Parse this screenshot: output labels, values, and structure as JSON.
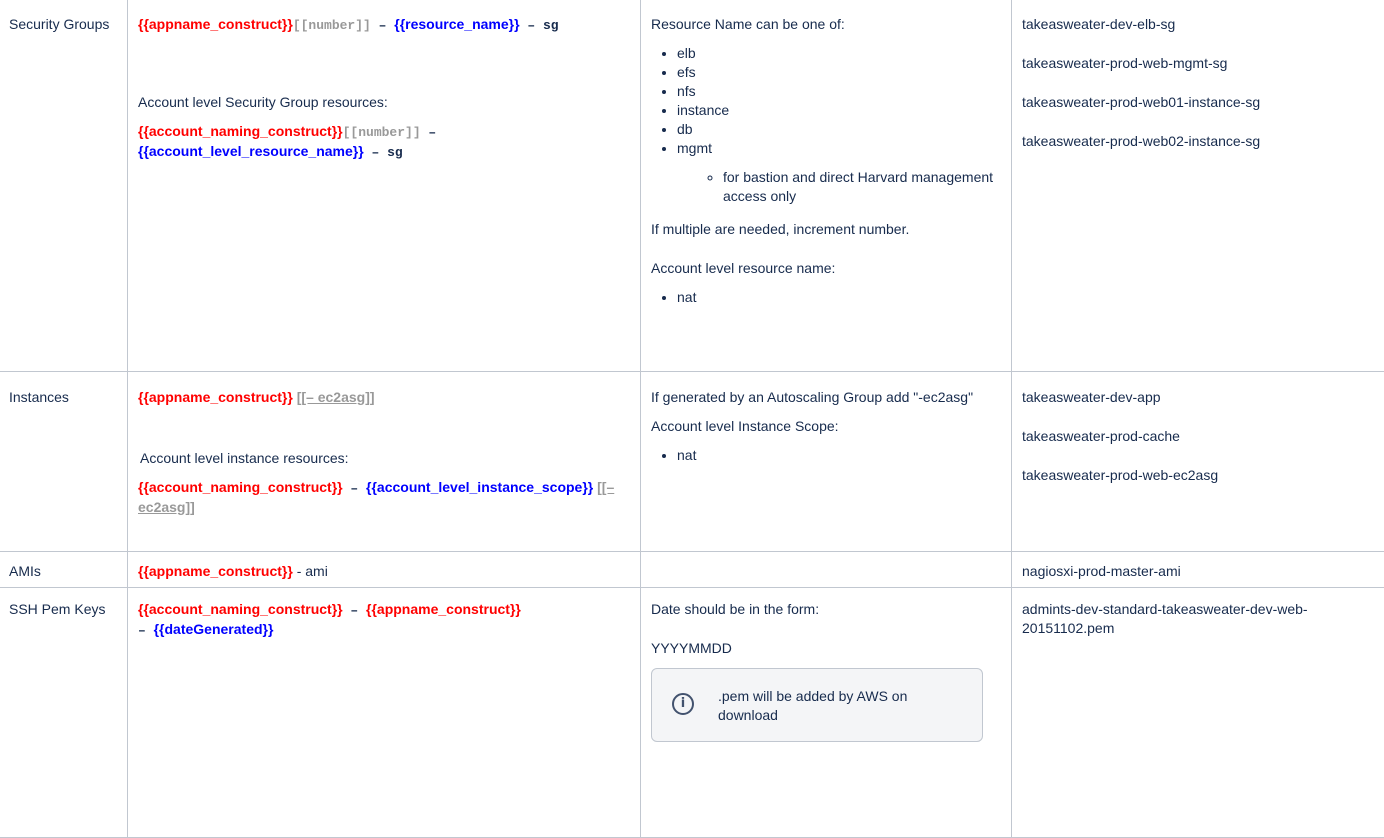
{
  "rows": {
    "sg": {
      "type": "Security Groups",
      "c2": {
        "l1_appname": "{{appname_construct}}",
        "l1_number": "[[number]]",
        "l1_dash": " – ",
        "l1_resource": "{{resource_name}}",
        "l1_suffix": " – sg",
        "account_label": "Account level Security Group resources:",
        "l2_account": "{{account_naming_construct}}",
        "l2_number": "[[number]]",
        "l2_dash": " – ",
        "l2_resource": "{{account_level_resource_name}}",
        "l2_suffix": " – sg"
      },
      "c3": {
        "intro": "Resource Name can be one of:",
        "items": [
          "elb",
          "efs",
          "nfs",
          "instance",
          "db",
          "mgmt"
        ],
        "mgmt_note": "for bastion and direct Harvard management access only",
        "multiple": "If multiple are needed, increment number.",
        "account_label": "Account level resource name:",
        "account_items": [
          "nat"
        ]
      },
      "examples": [
        "takeasweater-dev-elb-sg",
        "takeasweater-prod-web-mgmt-sg",
        "takeasweater-prod-web01-instance-sg",
        "takeasweater-prod-web02-instance-sg"
      ]
    },
    "inst": {
      "type": "Instances",
      "c2": {
        "l1_appname": "{{appname_construct}}",
        "l1_opt": "[[–   ec2asg]]",
        "account_label": "Account level instance resources:",
        "l2_account": "{{account_naming_construct}}",
        "l2_dash": " – ",
        "l2_scope": "{{account_level_instance_scope}}",
        "l2_opt": "[[–   ec2asg]]"
      },
      "c3": {
        "autoscaling": "If generated by an Autoscaling Group add \"-ec2asg\"",
        "account_label": "Account level Instance Scope:",
        "items": [
          "nat"
        ]
      },
      "examples": [
        "takeasweater-dev-app",
        "takeasweater-prod-cache",
        "takeasweater-prod-web-ec2asg"
      ]
    },
    "ami": {
      "type": "AMIs",
      "c2": {
        "appname": "{{appname_construct}}",
        "suffix": " - ami"
      },
      "examples": [
        "nagiosxi-prod-master-ami"
      ]
    },
    "ssh": {
      "type": "SSH Pem Keys",
      "c2": {
        "account": "{{account_naming_construct}}",
        "dash1": " – ",
        "appname": "{{appname_construct}}",
        "dash2": " – ",
        "date": "{{dateGenerated}}"
      },
      "c3": {
        "intro": "Date should be in the form:",
        "format": "YYYYMMDD",
        "info_icon": "info-icon",
        "info": ".pem will be added by AWS on download"
      },
      "examples": [
        "admints-dev-standard-takeasweater-dev-web-20151102.pem"
      ]
    }
  }
}
